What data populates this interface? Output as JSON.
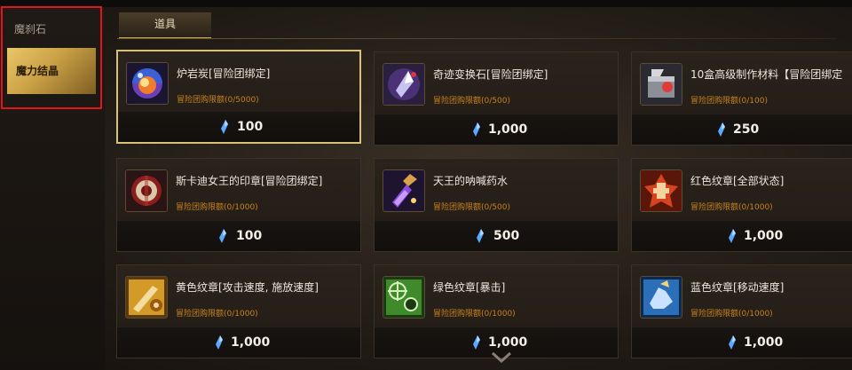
{
  "sidebar": {
    "items": [
      {
        "label": "魔刹石",
        "active": false
      },
      {
        "label": "魔力结晶",
        "active": true
      }
    ]
  },
  "tabs": [
    {
      "label": "道具",
      "active": true
    }
  ],
  "currency_icon": "blue-crystal-icon",
  "colors": {
    "gold": "#caa045",
    "limit_orange": "#c8821f",
    "selected_border": "#d8c27a",
    "highlight_red": "#e0161c"
  },
  "items": [
    {
      "name": "炉岩炭[冒险团绑定]",
      "limit": "冒险团购限额(0/5000)",
      "price": "100",
      "icon": "orb-icon",
      "selected": true
    },
    {
      "name": "奇迹变换石[冒险团绑定]",
      "limit": "冒险团购限额(0/500)",
      "price": "1,000",
      "icon": "crystal-shard-icon",
      "selected": false
    },
    {
      "name": "10盒高级制作材料【冒险团绑定",
      "limit": "冒险团购限额(0/100)",
      "price": "250",
      "icon": "material-box-icon",
      "selected": false
    },
    {
      "name": "斯卡迪女王的印章[冒险团绑定]",
      "limit": "冒险团购限额(0/1000)",
      "price": "100",
      "icon": "seal-icon",
      "selected": false
    },
    {
      "name": "天王的呐喊药水",
      "limit": "冒险团购限额(0/500)",
      "price": "500",
      "icon": "potion-icon",
      "selected": false
    },
    {
      "name": "红色纹章[全部状态]",
      "limit": "冒险团购限额(0/1000)",
      "price": "1,000",
      "icon": "red-emblem-icon",
      "selected": false
    },
    {
      "name": "黄色纹章[攻击速度, 施放速度]",
      "limit": "冒险团购限额(0/1000)",
      "price": "1,000",
      "icon": "yellow-emblem-icon",
      "selected": false
    },
    {
      "name": "绿色纹章[暴击]",
      "limit": "冒险团购限额(0/1000)",
      "price": "1,000",
      "icon": "green-emblem-icon",
      "selected": false
    },
    {
      "name": "蓝色纹章[移动速度]",
      "limit": "冒险团购限额(0/1000)",
      "price": "1,000",
      "icon": "blue-emblem-icon",
      "selected": false
    }
  ],
  "scroll_indicator": "chevron-down-icon"
}
